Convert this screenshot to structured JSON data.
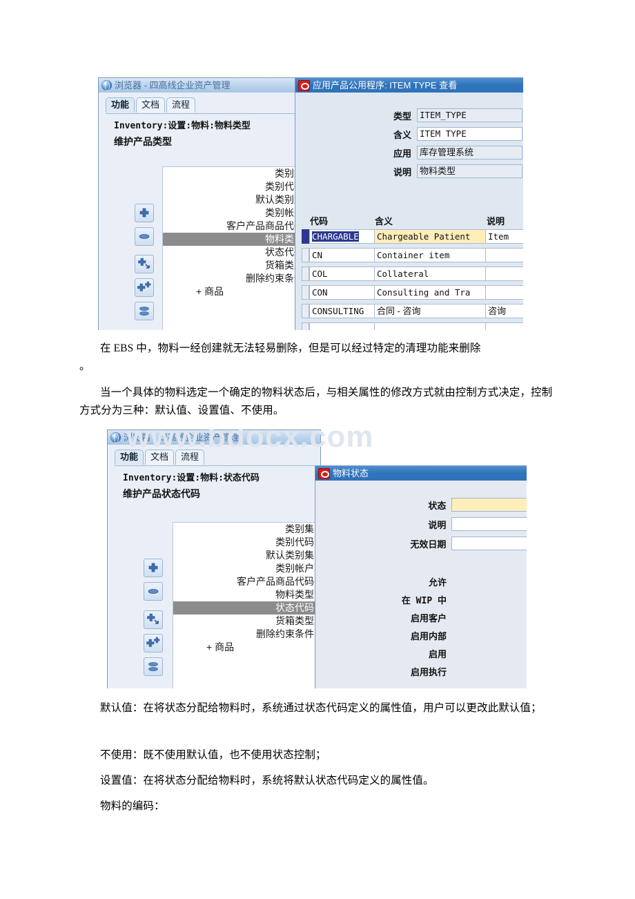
{
  "document": {
    "watermark": "www.bdocx.com",
    "paragraphs": [
      {
        "id": "p1",
        "text": "在 EBS 中，物料一经创建就无法轻易删除，但是可以经过特定的清理功能来删除"
      },
      {
        "id": "p1b",
        "text": "。"
      },
      {
        "id": "p2",
        "text": "当一个具体的物料选定一个确定的物料状态后，与相关属性的修改方式就由控制方式决定，控制方式分为三种：默认值、设置值、不使用。"
      },
      {
        "id": "p3",
        "text": "默认值：在将状态分配给物料时，系统通过状态代码定义的属性值，用户可以更改此默认值；"
      },
      {
        "id": "p4",
        "text": "不使用：既不使用默认值，也不使用状态控制；"
      },
      {
        "id": "p5",
        "text": "设置值：在将状态分配给物料时，系统将默认状态代码定义的属性值。"
      },
      {
        "id": "p6",
        "text": "物料的编码："
      }
    ]
  },
  "screenshot_one": {
    "browser_window": {
      "title": "浏览器 - 四高线企业资产管理",
      "tabs": [
        {
          "label": "功能",
          "active": true
        },
        {
          "label": "文档",
          "active": false
        },
        {
          "label": "流程",
          "active": false
        }
      ],
      "breadcrumb": "Inventory:设置:物料:物料类型",
      "subtitle": "维护产品类型",
      "tree_items": [
        {
          "label": "类别集",
          "selected": false
        },
        {
          "label": "类别代码",
          "selected": false
        },
        {
          "label": "默认类别集",
          "selected": false
        },
        {
          "label": "类别帐户",
          "selected": false
        },
        {
          "label": "客户产品商品代码",
          "selected": false
        },
        {
          "label": "物料类型",
          "selected": true
        },
        {
          "label": "状态代码",
          "selected": false
        },
        {
          "label": "货箱类型",
          "selected": false
        },
        {
          "label": "删除约束条件",
          "selected": false
        },
        {
          "label": "+    商品",
          "selected": false
        }
      ],
      "side_buttons": [
        {
          "name": "add-button",
          "glyph": "plus"
        },
        {
          "name": "remove-button",
          "glyph": "minus"
        },
        {
          "name": "add-child-button",
          "glyph": "plus-arrow"
        },
        {
          "name": "add-sibling-button",
          "glyph": "plus-plus"
        },
        {
          "name": "collapse-button",
          "glyph": "stack"
        }
      ]
    },
    "forms_window": {
      "title": "应用产品公用程序: ITEM TYPE 查看",
      "fields": [
        {
          "label": "类型",
          "value": "ITEM_TYPE",
          "style": "grey"
        },
        {
          "label": "含义",
          "value": "ITEM TYPE",
          "style": "white"
        },
        {
          "label": "应用",
          "value": "库存管理系统",
          "style": "grey"
        },
        {
          "label": "说明",
          "value": "物料类型",
          "style": "grey"
        }
      ],
      "grid": {
        "headers": [
          "代码",
          "含义",
          "说明"
        ],
        "rows": [
          {
            "code": "CHARGABLE",
            "meaning": "Chargeable Patient",
            "desc": "Item ",
            "current": true
          },
          {
            "code": "CN",
            "meaning": "Container item",
            "desc": "",
            "current": false
          },
          {
            "code": "COL",
            "meaning": "Collateral",
            "desc": "",
            "current": false
          },
          {
            "code": "CON",
            "meaning": "Consulting and Tra",
            "desc": "",
            "current": false
          },
          {
            "code": "CONSULTING",
            "meaning": "合同 - 咨询",
            "desc": "咨询",
            "current": false
          }
        ]
      }
    }
  },
  "screenshot_two": {
    "browser_window": {
      "title": "浏览器 - 四高线企业资产管理",
      "tabs": [
        {
          "label": "功能",
          "active": true
        },
        {
          "label": "文档",
          "active": false
        },
        {
          "label": "流程",
          "active": false
        }
      ],
      "breadcrumb": "Inventory:设置:物料:状态代码",
      "subtitle": "维护产品状态代码",
      "tree_items": [
        {
          "label": "类别集",
          "selected": false
        },
        {
          "label": "类别代码",
          "selected": false
        },
        {
          "label": "默认类别集",
          "selected": false
        },
        {
          "label": "类别帐户",
          "selected": false
        },
        {
          "label": "客户产品商品代码",
          "selected": false
        },
        {
          "label": "物料类型",
          "selected": false
        },
        {
          "label": "状态代码",
          "selected": true
        },
        {
          "label": "货箱类型",
          "selected": false
        },
        {
          "label": "删除约束条件",
          "selected": false
        },
        {
          "label": "+    商品",
          "selected": false
        }
      ],
      "side_buttons": [
        {
          "name": "add-button",
          "glyph": "plus"
        },
        {
          "name": "remove-button",
          "glyph": "minus"
        },
        {
          "name": "add-child-button",
          "glyph": "plus-arrow"
        },
        {
          "name": "add-sibling-button",
          "glyph": "plus-plus"
        },
        {
          "name": "collapse-button",
          "glyph": "stack"
        }
      ]
    },
    "forms_window": {
      "title": "物料状态",
      "fields": [
        {
          "label": "状态",
          "value": "",
          "style": "yellow"
        },
        {
          "label": "说明",
          "value": "",
          "style": "white"
        },
        {
          "label": "无效日期",
          "value": "",
          "style": "white"
        }
      ],
      "checkbox_labels": [
        "允许",
        "在 WIP 中",
        "启用客户",
        "启用内部",
        "启用",
        "启用执行"
      ]
    }
  },
  "colors": {
    "forms_title_blue": "#2f73ba",
    "browser_title_blue": "#a6c6e6",
    "selection_grey": "#8c8c8c",
    "highlight_yellow": "#ffeeba",
    "current_record_navy": "#2b3990",
    "oracle_red": "#d51b1b",
    "watermark_grey": "#dfe6ee"
  }
}
